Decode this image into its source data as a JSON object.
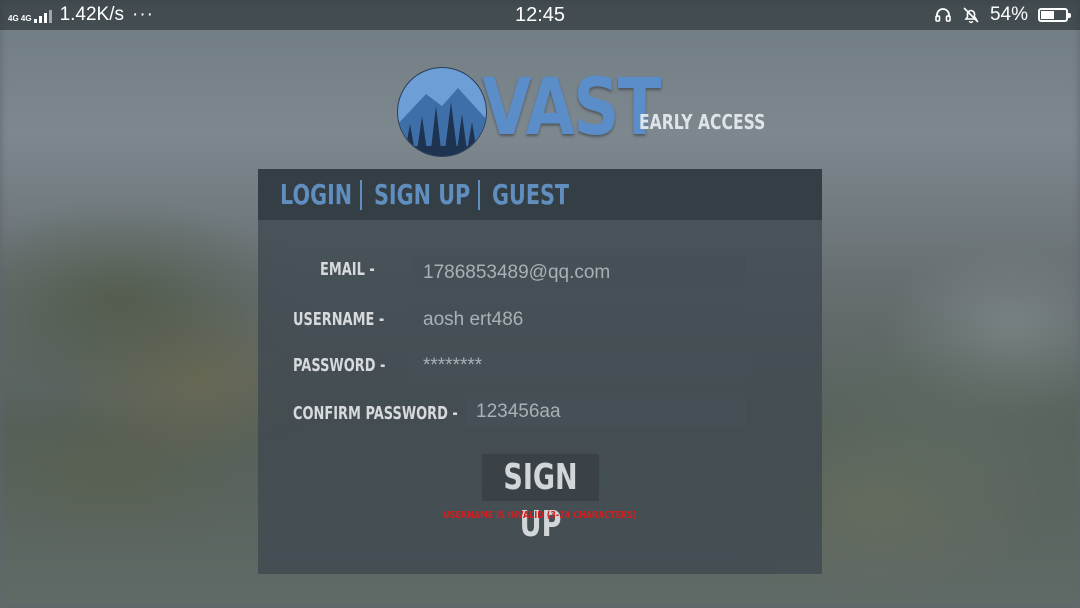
{
  "status_bar": {
    "network_type": "4G 4G",
    "speed": "1.42K/s",
    "more": "···",
    "time": "12:45",
    "battery_percent": "54%",
    "battery_level": 0.54,
    "icons": [
      "signal-icon",
      "headset-icon",
      "mute-bell-icon",
      "battery-icon"
    ]
  },
  "logo": {
    "word": "VAST",
    "tag": "EARLY ACCESS",
    "brand_color": "#5b8dc9"
  },
  "tabs": [
    {
      "label": "LOGIN"
    },
    {
      "label": "SIGN UP"
    },
    {
      "label": "GUEST"
    }
  ],
  "form": {
    "email": {
      "label": "EMAIL  -",
      "value": "1786853489@qq.com"
    },
    "username": {
      "label": "USERNAME -",
      "value": "aosh ert486"
    },
    "password": {
      "label": "PASSWORD -",
      "value": "********"
    },
    "confirm_password": {
      "label": "CONFIRM PASSWORD -",
      "value": "123456aa"
    },
    "submit_label": "SIGN UP",
    "error": "USERNAME IS INVALID (3-24 CHARACTERS)",
    "error_color": "#d21f1f"
  }
}
